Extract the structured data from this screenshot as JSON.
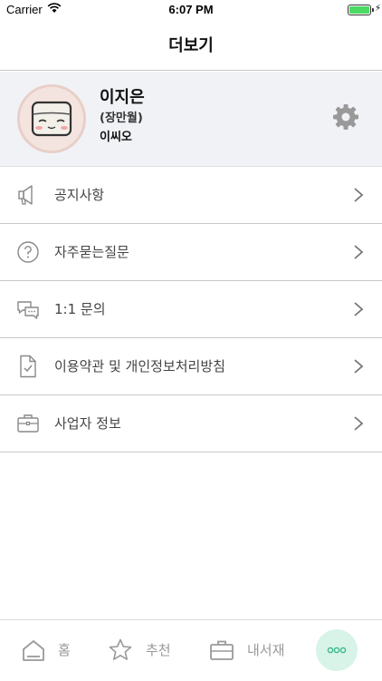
{
  "status_bar": {
    "carrier": "Carrier",
    "time": "6:07 PM",
    "battery_level": 1.0
  },
  "nav": {
    "title": "더보기"
  },
  "profile": {
    "name": "이지은",
    "sub_name": "(장만월)",
    "nickname": "이씨오",
    "settings_icon": "gear-icon"
  },
  "menu": {
    "items": [
      {
        "label": "공지사항",
        "icon": "megaphone-icon"
      },
      {
        "label": "자주묻는질문",
        "icon": "question-icon"
      },
      {
        "label": "1:1 문의",
        "icon": "chat-bubbles-icon"
      },
      {
        "label": "이용약관 및 개인정보처리방침",
        "icon": "document-check-icon"
      },
      {
        "label": "사업자 정보",
        "icon": "briefcase-icon"
      }
    ]
  },
  "tabbar": {
    "tabs": [
      {
        "label": "홈",
        "icon": "home-icon"
      },
      {
        "label": "추천",
        "icon": "star-icon"
      },
      {
        "label": "내서재",
        "icon": "briefcase-icon"
      }
    ],
    "more_icon": "more-dots-icon",
    "accent": "#d8f3e8"
  }
}
